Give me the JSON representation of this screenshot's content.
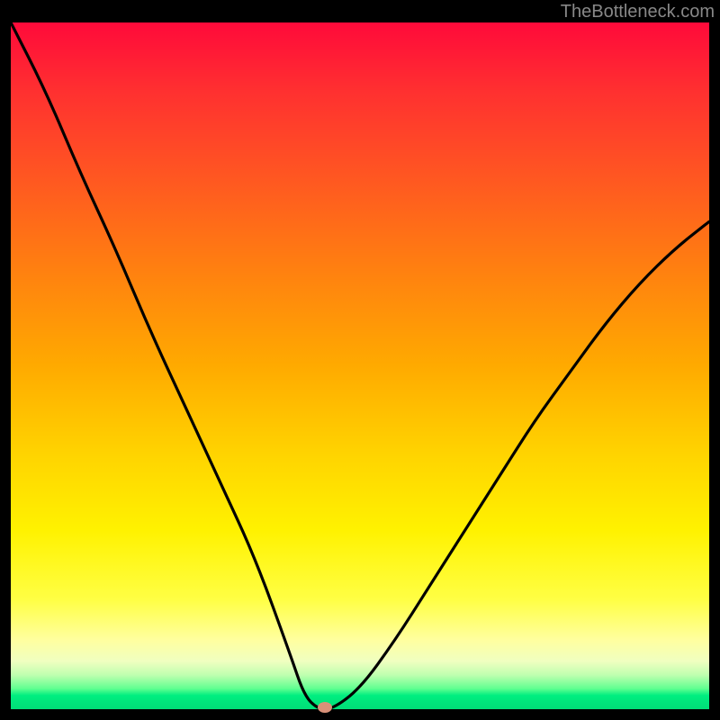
{
  "watermark": "TheBottleneck.com",
  "chart_data": {
    "type": "line",
    "title": "",
    "xlabel": "",
    "ylabel": "",
    "note": "Plot shows a bottleneck/mismatch curve over a vertical rainbow gradient (red=high mismatch at top → green=low mismatch at bottom). The black curve descends steeply from the upper-left, reaches a minimum near x≈0.44 (approximately zero mismatch), then rises again toward the right. A salmon-colored marker sits at the minimum.",
    "x_range": [
      0,
      1
    ],
    "y_range": [
      0,
      1
    ],
    "series": [
      {
        "name": "mismatch-curve",
        "x": [
          0.0,
          0.05,
          0.1,
          0.15,
          0.2,
          0.25,
          0.3,
          0.35,
          0.4,
          0.42,
          0.44,
          0.46,
          0.5,
          0.55,
          0.6,
          0.65,
          0.7,
          0.75,
          0.8,
          0.85,
          0.9,
          0.95,
          1.0
        ],
        "y": [
          1.0,
          0.9,
          0.78,
          0.67,
          0.55,
          0.44,
          0.33,
          0.22,
          0.08,
          0.02,
          0.0,
          0.0,
          0.03,
          0.1,
          0.18,
          0.26,
          0.34,
          0.42,
          0.49,
          0.56,
          0.62,
          0.67,
          0.71
        ]
      }
    ],
    "marker": {
      "x": 0.45,
      "y": 0.003
    },
    "gradient_meaning": "vertical background: top=red (worst), bottom=green (best)"
  }
}
